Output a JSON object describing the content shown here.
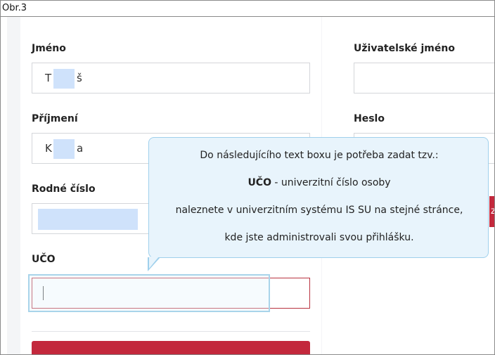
{
  "caption": "Obr.3",
  "form": {
    "jmeno": {
      "label": "Jméno",
      "value_start": "T",
      "value_end": "š"
    },
    "prijmeni": {
      "label": "Příjmení",
      "value_start": "K",
      "value_end": "a"
    },
    "rodne_cislo": {
      "label": "Rodné číslo"
    },
    "uco": {
      "label": "UČO"
    },
    "uzivatelske_jmeno": {
      "label": "Uživatelské jméno"
    },
    "heslo": {
      "label": "Heslo"
    },
    "submit_right_partial": "z"
  },
  "tooltip": {
    "line1": "Do následujícího text boxu je potřeba zadat tzv.:",
    "line2_bold": "UČO",
    "line2_rest": " - univerzitní číslo osoby",
    "line3": "naleznete v univerzitním systému IS SU na stejné stránce,",
    "line4": "kde jste administrovali svou přihlášku."
  },
  "colors": {
    "accent": "#c3283c",
    "tooltip_bg": "#e8f4fc",
    "tooltip_border": "#9fd0ec",
    "redaction": "#cfe2fb"
  }
}
